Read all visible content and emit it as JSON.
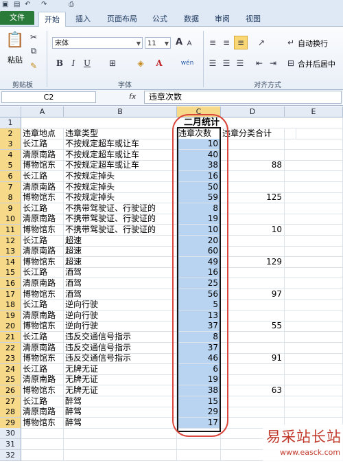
{
  "tabs": [
    "文件",
    "开始",
    "插入",
    "页面布局",
    "公式",
    "数据",
    "审阅",
    "视图"
  ],
  "ribbon": {
    "paste_label": "粘贴",
    "clipboard_label": "剪贴板",
    "font_name": "宋体",
    "font_size": "11",
    "font_group_label": "字体",
    "align_group_label": "对齐方式",
    "wrap_text": "自动换行",
    "merge_center": "合并后居中",
    "bold": "B",
    "italic": "I",
    "underline": "U",
    "grow_font": "A",
    "shrink_font": "A",
    "phonetic": "wén"
  },
  "formula_bar": {
    "name_box": "C2",
    "fx": "fx",
    "formula": "违章次数"
  },
  "columns": [
    "A",
    "B",
    "C",
    "D",
    "E"
  ],
  "rows": [
    "1",
    "2",
    "3",
    "4",
    "5",
    "6",
    "7",
    "8",
    "9",
    "10",
    "11",
    "12",
    "13",
    "14",
    "15",
    "16",
    "17",
    "18",
    "19",
    "20",
    "21",
    "22",
    "23",
    "24",
    "25",
    "26",
    "27",
    "28",
    "29",
    "30",
    "31",
    "32"
  ],
  "sheet": {
    "title": "二月统计",
    "headers": [
      "违章地点",
      "违章类型",
      "违章次数",
      "违章分类合计"
    ],
    "data": [
      [
        "长江路",
        "不按规定超车或让车",
        "10",
        ""
      ],
      [
        "清原南路",
        "不按规定超车或让车",
        "40",
        ""
      ],
      [
        "博物馆东",
        "不按规定超车或让车",
        "38",
        "88"
      ],
      [
        "长江路",
        "不按规定掉头",
        "16",
        ""
      ],
      [
        "清原南路",
        "不按规定掉头",
        "50",
        ""
      ],
      [
        "博物馆东",
        "不按规定掉头",
        "59",
        "125"
      ],
      [
        "长江路",
        "不携带驾驶证、行驶证的",
        "8",
        ""
      ],
      [
        "清原南路",
        "不携带驾驶证、行驶证的",
        "19",
        ""
      ],
      [
        "博物馆东",
        "不携带驾驶证、行驶证的",
        "10",
        "10"
      ],
      [
        "长江路",
        "超速",
        "20",
        ""
      ],
      [
        "清原南路",
        "超速",
        "60",
        ""
      ],
      [
        "博物馆东",
        "超速",
        "49",
        "129"
      ],
      [
        "长江路",
        "酒驾",
        "16",
        ""
      ],
      [
        "清原南路",
        "酒驾",
        "25",
        ""
      ],
      [
        "博物馆东",
        "酒驾",
        "56",
        "97"
      ],
      [
        "长江路",
        "逆向行驶",
        "5",
        ""
      ],
      [
        "清原南路",
        "逆向行驶",
        "13",
        ""
      ],
      [
        "博物馆东",
        "逆向行驶",
        "37",
        "55"
      ],
      [
        "长江路",
        "违反交通信号指示",
        "8",
        ""
      ],
      [
        "清原南路",
        "违反交通信号指示",
        "37",
        ""
      ],
      [
        "博物馆东",
        "违反交通信号指示",
        "46",
        "91"
      ],
      [
        "长江路",
        "无牌无证",
        "6",
        ""
      ],
      [
        "清原南路",
        "无牌无证",
        "19",
        ""
      ],
      [
        "博物馆东",
        "无牌无证",
        "38",
        "63"
      ],
      [
        "长江路",
        "醉驾",
        "15",
        ""
      ],
      [
        "清原南路",
        "醉驾",
        "29",
        ""
      ],
      [
        "博物馆东",
        "醉驾",
        "17",
        ""
      ]
    ]
  },
  "watermark": {
    "title": "易采站长站",
    "url": "www.easck.com"
  },
  "colors": {
    "file_tab": "#2a7a3a",
    "selection": "#b9d4f0",
    "header_highlight": "#f7d98a",
    "annotation": "#d9463c"
  }
}
